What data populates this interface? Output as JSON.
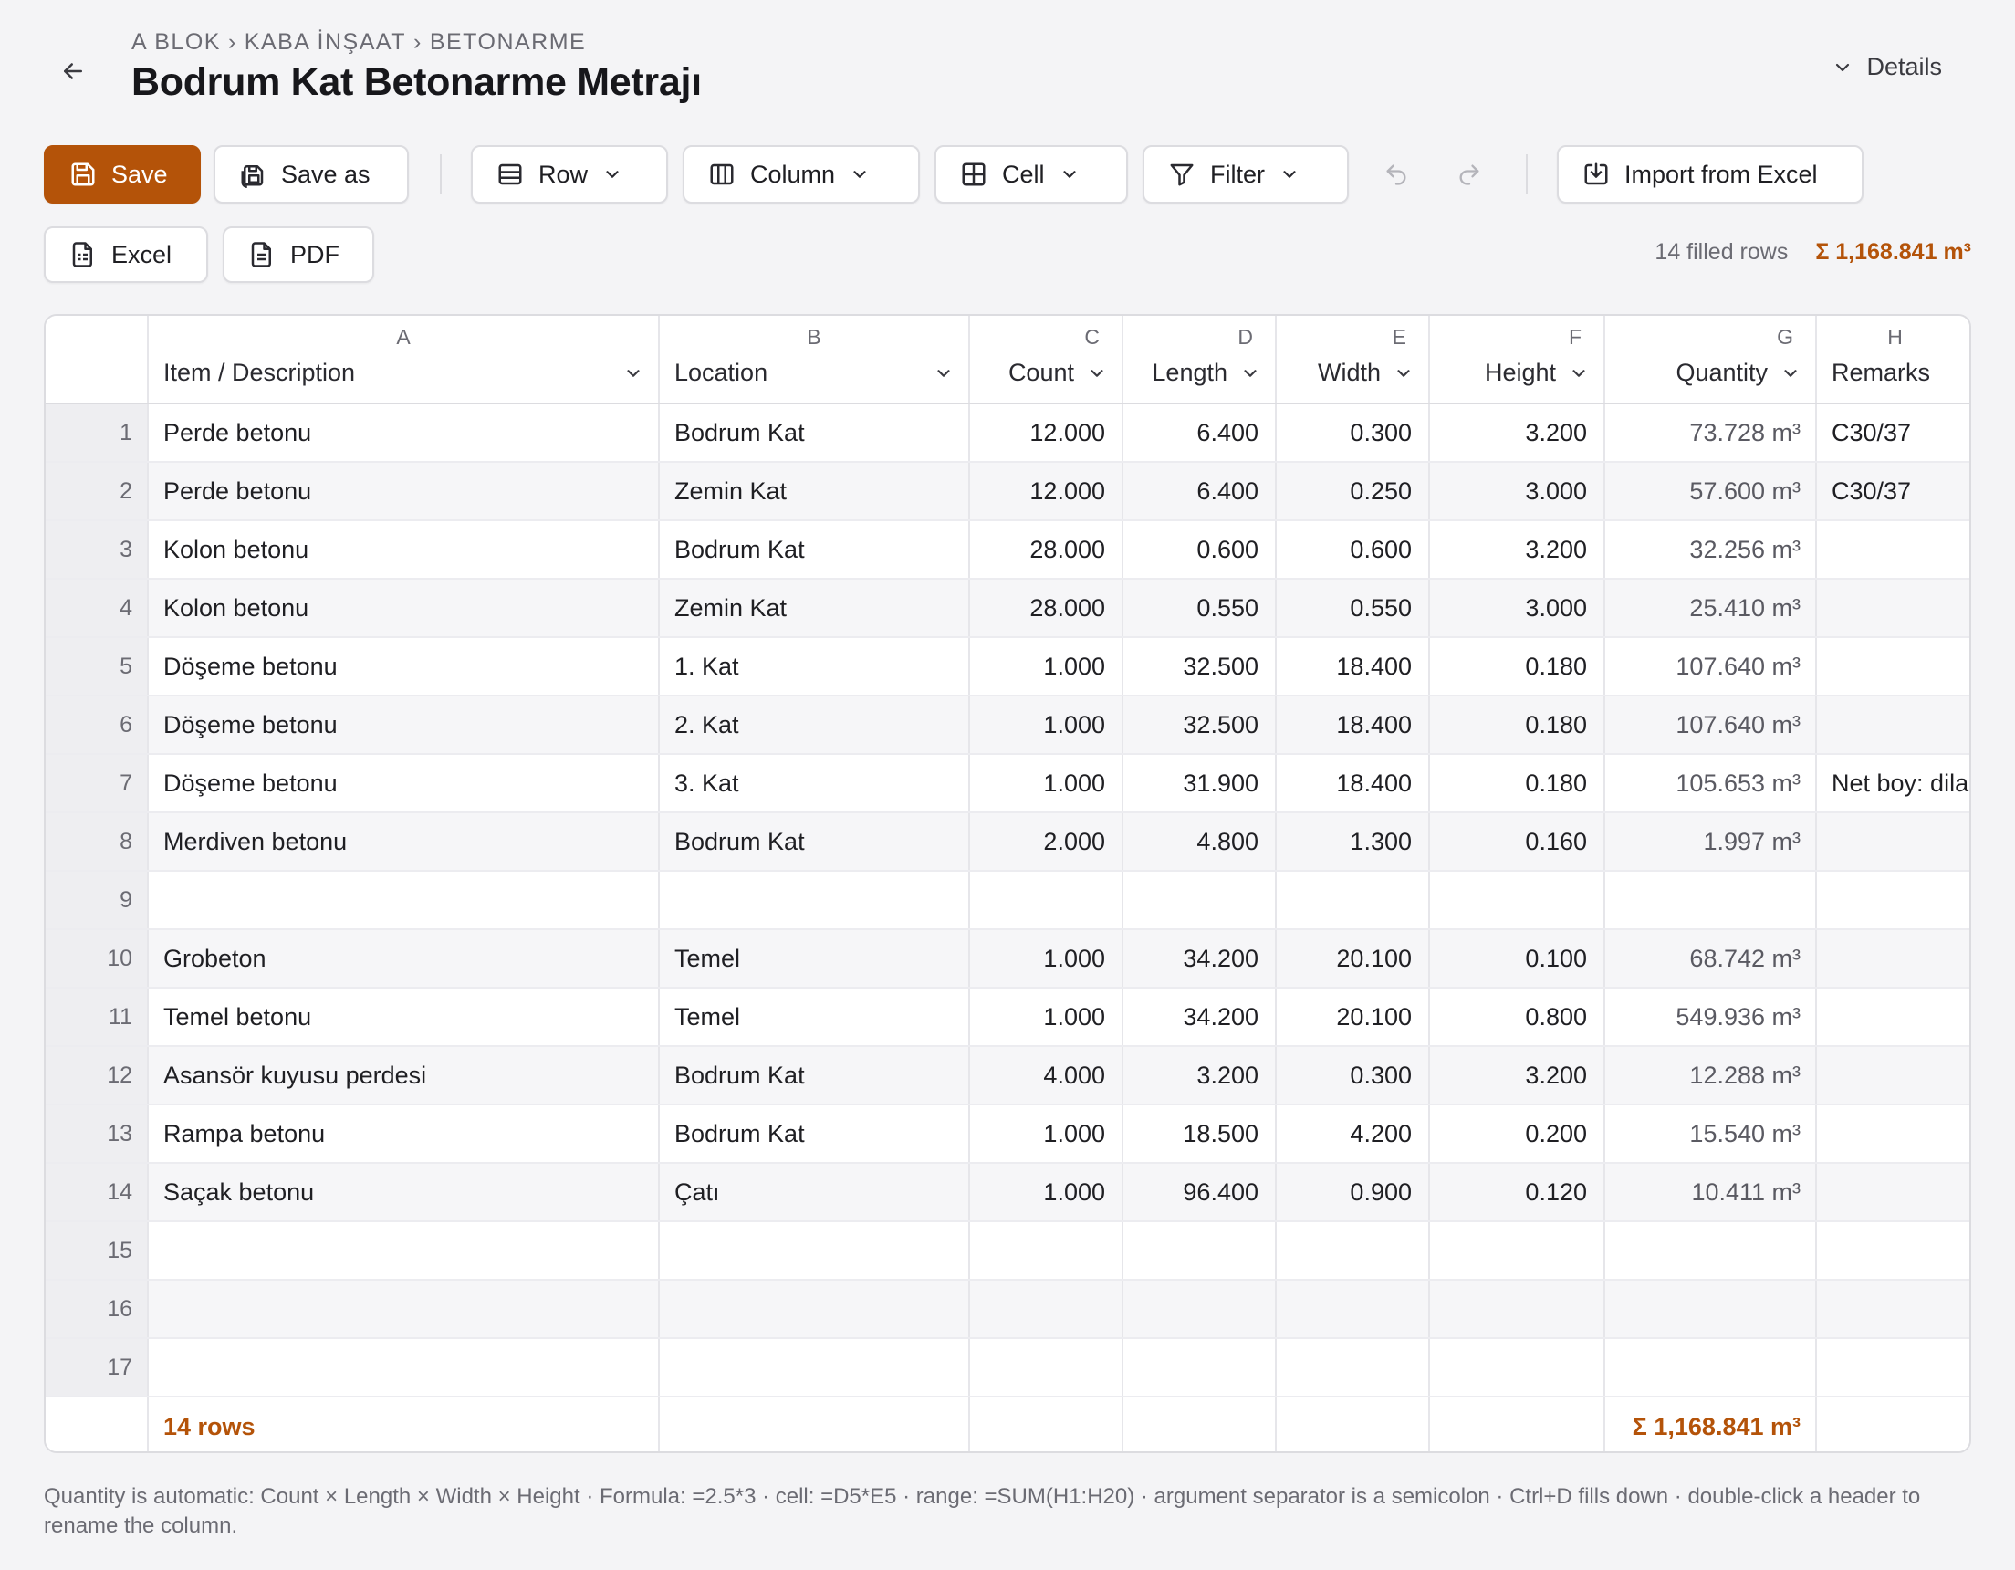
{
  "header": {
    "breadcrumb": [
      "A BLOK",
      "KABA İNŞAAT",
      "BETONARME"
    ],
    "title": "Bodrum Kat Betonarme Metrajı",
    "details_label": "Details"
  },
  "toolbar": {
    "save_label": "Save",
    "save_as_label": "Save as",
    "row_label": "Row",
    "column_label": "Column",
    "cell_label": "Cell",
    "filter_label": "Filter",
    "import_label": "Import from Excel",
    "excel_label": "Excel",
    "pdf_label": "PDF"
  },
  "summary": {
    "filled_rows": "14 filled rows",
    "total": "Σ 1,168.841 m³"
  },
  "columns": [
    {
      "letter": "A",
      "title": "Item / Description"
    },
    {
      "letter": "B",
      "title": "Location"
    },
    {
      "letter": "C",
      "title": "Count"
    },
    {
      "letter": "D",
      "title": "Length"
    },
    {
      "letter": "E",
      "title": "Width"
    },
    {
      "letter": "F",
      "title": "Height"
    },
    {
      "letter": "G",
      "title": "Quantity"
    },
    {
      "letter": "H",
      "title": "Remarks"
    }
  ],
  "rows": [
    {
      "n": "1",
      "item": "Perde betonu",
      "location": "Bodrum Kat",
      "count": "12.000",
      "length": "6.400",
      "width": "0.300",
      "height": "3.200",
      "quantity": "73.728 m³",
      "remarks": "C30/37"
    },
    {
      "n": "2",
      "item": "Perde betonu",
      "location": "Zemin Kat",
      "count": "12.000",
      "length": "6.400",
      "width": "0.250",
      "height": "3.000",
      "quantity": "57.600 m³",
      "remarks": "C30/37"
    },
    {
      "n": "3",
      "item": "Kolon betonu",
      "location": "Bodrum Kat",
      "count": "28.000",
      "length": "0.600",
      "width": "0.600",
      "height": "3.200",
      "quantity": "32.256 m³",
      "remarks": ""
    },
    {
      "n": "4",
      "item": "Kolon betonu",
      "location": "Zemin Kat",
      "count": "28.000",
      "length": "0.550",
      "width": "0.550",
      "height": "3.000",
      "quantity": "25.410 m³",
      "remarks": ""
    },
    {
      "n": "5",
      "item": "Döşeme betonu",
      "location": "1. Kat",
      "count": "1.000",
      "length": "32.500",
      "width": "18.400",
      "height": "0.180",
      "quantity": "107.640 m³",
      "remarks": ""
    },
    {
      "n": "6",
      "item": "Döşeme betonu",
      "location": "2. Kat",
      "count": "1.000",
      "length": "32.500",
      "width": "18.400",
      "height": "0.180",
      "quantity": "107.640 m³",
      "remarks": ""
    },
    {
      "n": "7",
      "item": "Döşeme betonu",
      "location": "3. Kat",
      "count": "1.000",
      "length": "31.900",
      "width": "18.400",
      "height": "0.180",
      "quantity": "105.653 m³",
      "remarks": "Net boy: dila"
    },
    {
      "n": "8",
      "item": "Merdiven betonu",
      "location": "Bodrum Kat",
      "count": "2.000",
      "length": "4.800",
      "width": "1.300",
      "height": "0.160",
      "quantity": "1.997 m³",
      "remarks": ""
    },
    {
      "n": "9",
      "item": "",
      "location": "",
      "count": "",
      "length": "",
      "width": "",
      "height": "",
      "quantity": "",
      "remarks": ""
    },
    {
      "n": "10",
      "item": "Grobeton",
      "location": "Temel",
      "count": "1.000",
      "length": "34.200",
      "width": "20.100",
      "height": "0.100",
      "quantity": "68.742 m³",
      "remarks": ""
    },
    {
      "n": "11",
      "item": "Temel betonu",
      "location": "Temel",
      "count": "1.000",
      "length": "34.200",
      "width": "20.100",
      "height": "0.800",
      "quantity": "549.936 m³",
      "remarks": ""
    },
    {
      "n": "12",
      "item": "Asansör kuyusu perdesi",
      "location": "Bodrum Kat",
      "count": "4.000",
      "length": "3.200",
      "width": "0.300",
      "height": "3.200",
      "quantity": "12.288 m³",
      "remarks": ""
    },
    {
      "n": "13",
      "item": "Rampa betonu",
      "location": "Bodrum Kat",
      "count": "1.000",
      "length": "18.500",
      "width": "4.200",
      "height": "0.200",
      "quantity": "15.540 m³",
      "remarks": ""
    },
    {
      "n": "14",
      "item": "Saçak betonu",
      "location": "Çatı",
      "count": "1.000",
      "length": "96.400",
      "width": "0.900",
      "height": "0.120",
      "quantity": "10.411 m³",
      "remarks": ""
    },
    {
      "n": "15",
      "item": "",
      "location": "",
      "count": "",
      "length": "",
      "width": "",
      "height": "",
      "quantity": "",
      "remarks": ""
    },
    {
      "n": "16",
      "item": "",
      "location": "",
      "count": "",
      "length": "",
      "width": "",
      "height": "",
      "quantity": "",
      "remarks": ""
    },
    {
      "n": "17",
      "item": "",
      "location": "",
      "count": "",
      "length": "",
      "width": "",
      "height": "",
      "quantity": "",
      "remarks": ""
    }
  ],
  "footer": {
    "rows_label": "14 rows",
    "total": "Σ 1,168.841 m³"
  },
  "footnote": "Quantity is automatic: Count × Length × Width × Height · Formula: =2.5*3 · cell: =D5*E5 · range: =SUM(H1:H20) · argument separator is a semicolon · Ctrl+D fills down · double-click a header to rename the column.",
  "colors": {
    "accent": "#b45309",
    "background": "#f4f4f6",
    "row_alt": "#f6f6f8",
    "row_number_bg": "#eeeef1",
    "border": "#dcdce0"
  },
  "icons": {
    "back": "arrow-left-icon",
    "details": "chevron-down-icon",
    "save": "save-icon",
    "save_as": "save-as-icon",
    "row": "rows-icon",
    "column": "columns-icon",
    "cell": "grid-icon",
    "filter": "filter-icon",
    "undo": "undo-icon",
    "redo": "redo-icon",
    "import": "import-icon",
    "excel": "spreadsheet-file-icon",
    "pdf": "document-file-icon"
  }
}
